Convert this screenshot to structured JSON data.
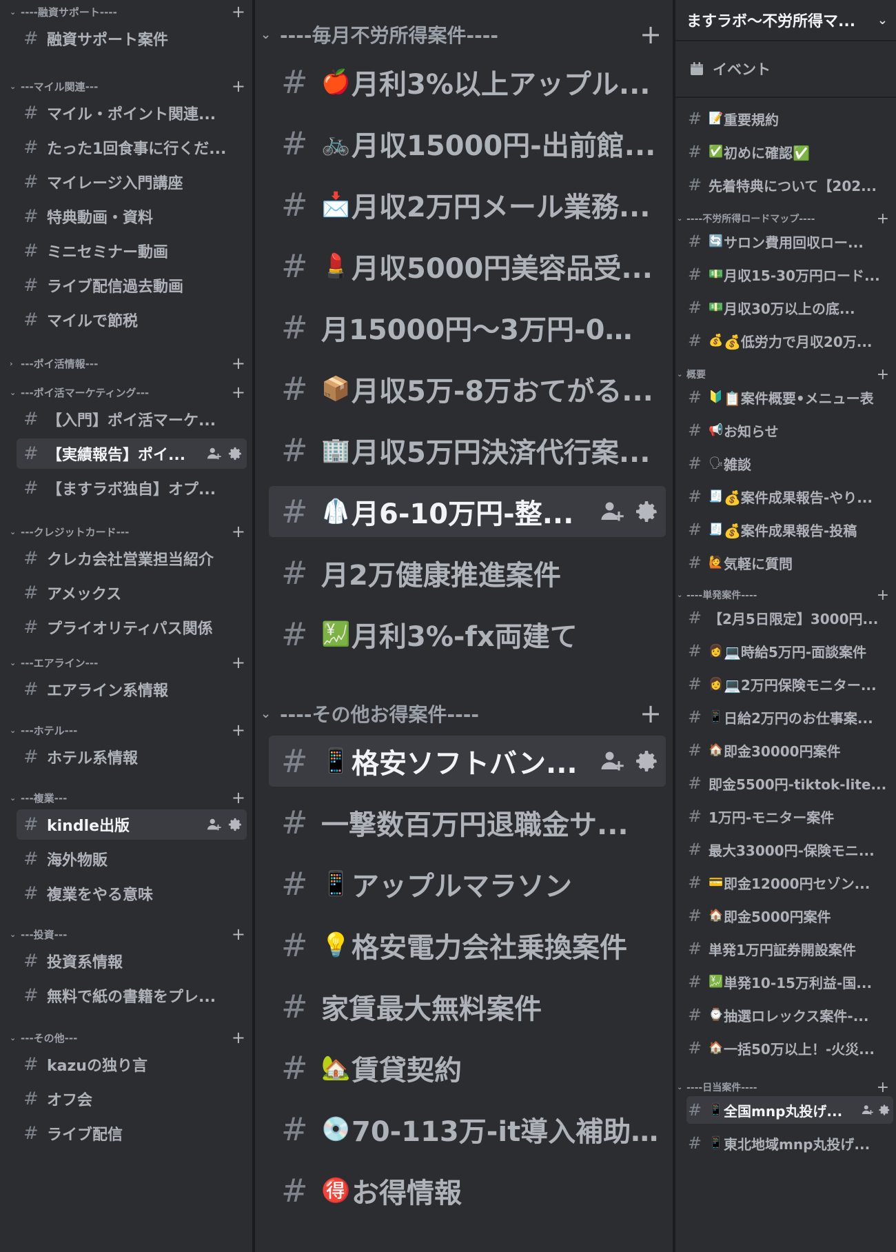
{
  "col1": {
    "groups": [
      {
        "category": "----融資サポート----",
        "chevron": "⌄",
        "channels": [
          {
            "name": "融資サポート案件"
          }
        ]
      },
      {
        "category": "---マイル関連---",
        "chevron": "⌄",
        "channels": [
          {
            "name": "マイル・ポイント関連..."
          },
          {
            "name": "たった1回食事に行くだ..."
          },
          {
            "name": "マイレージ入門講座"
          },
          {
            "name": "特典動画・資料"
          },
          {
            "name": "ミニセミナー動画"
          },
          {
            "name": "ライブ配信過去動画"
          },
          {
            "name": "マイルで節税"
          }
        ]
      },
      {
        "category": "---ポイ活情報---",
        "chevron": "›",
        "channels": []
      },
      {
        "category": "---ポイ活マーケティング---",
        "chevron": "⌄",
        "channels": [
          {
            "name": "【入門】ポイ活マーケ..."
          },
          {
            "name": "【実績報告】ポイ...",
            "selected": true
          },
          {
            "name": "【ますラボ独自】オプ..."
          }
        ]
      },
      {
        "category": "---クレジットカード---",
        "chevron": "⌄",
        "channels": [
          {
            "name": "クレカ会社営業担当紹介"
          },
          {
            "name": "アメックス"
          },
          {
            "name": "プライオリティパス関係"
          }
        ]
      },
      {
        "category": "---エアライン---",
        "chevron": "⌄",
        "channels": [
          {
            "name": "エアライン系情報"
          }
        ]
      },
      {
        "category": "---ホテル---",
        "chevron": "⌄",
        "channels": [
          {
            "name": "ホテル系情報"
          }
        ]
      },
      {
        "category": "---複業---",
        "chevron": "⌄",
        "channels": [
          {
            "name": "kindle出版",
            "selected": true
          },
          {
            "name": "海外物販"
          },
          {
            "name": "複業をやる意味"
          }
        ]
      },
      {
        "category": "---投資---",
        "chevron": "⌄",
        "channels": [
          {
            "name": "投資系情報"
          },
          {
            "name": "無料で紙の書籍をプレ..."
          }
        ]
      },
      {
        "category": "---その他---",
        "chevron": "⌄",
        "channels": [
          {
            "name": "kazuの独り言"
          },
          {
            "name": "オフ会"
          },
          {
            "name": "ライブ配信"
          }
        ]
      }
    ]
  },
  "col2": {
    "groups": [
      {
        "category": "----毎月不労所得案件----",
        "chevron": "⌄",
        "channels": [
          {
            "emoji": "🍎",
            "name": "月利3%以上アップル..."
          },
          {
            "emoji": "🚲",
            "name": "月収15000円-出前館..."
          },
          {
            "emoji": "📩",
            "name": "月収2万円メール業務..."
          },
          {
            "emoji": "💄",
            "name": "月収5000円美容品受..."
          },
          {
            "emoji": "",
            "name": "月15000円〜3万円-0円..."
          },
          {
            "emoji": "📦",
            "name": "月収5万-8万おてがる..."
          },
          {
            "emoji": "🏢",
            "name": "月収5万円決済代行案..."
          },
          {
            "emoji": "🥼",
            "name": "月6-10万円-整...",
            "selected": true
          },
          {
            "emoji": "",
            "name": "月2万健康推進案件"
          },
          {
            "emoji": "💹",
            "name": "月利3%-fx両建て"
          }
        ]
      },
      {
        "category": "----その他お得案件----",
        "chevron": "⌄",
        "channels": [
          {
            "emoji": "📱",
            "name": "格安ソフトバン...",
            "selected": true
          },
          {
            "emoji": "",
            "name": "一撃数百万円退職金サ..."
          },
          {
            "emoji": "📱",
            "name": "アップルマラソン"
          },
          {
            "emoji": "💡",
            "name": "格安電力会社乗換案件"
          },
          {
            "emoji": "",
            "name": "家賃最大無料案件"
          },
          {
            "emoji": "🏡",
            "name": "賃貸契約"
          },
          {
            "emoji": "💿",
            "name": "70-113万-it導入補助..."
          },
          {
            "emoji": "🉐",
            "name": "お得情報",
            "unread": true
          }
        ]
      }
    ]
  },
  "col3": {
    "server_name": "ますラボ〜不労所得マ...",
    "events_label": "イベント",
    "groups": [
      {
        "category": "",
        "chevron": "",
        "channels": [
          {
            "emoji": "📝",
            "name": "重要規約"
          },
          {
            "emoji": "✅",
            "name": "初めに確認✅"
          },
          {
            "emoji": "",
            "name": "先着特典について【202..."
          }
        ]
      },
      {
        "category": "----不労所得ロードマップ----",
        "chevron": "⌄",
        "channels": [
          {
            "emoji": "🔄",
            "name": "サロン費用回収ロー..."
          },
          {
            "emoji": "💵",
            "name": "月収15-30万円ロード..."
          },
          {
            "emoji": "💵",
            "name": "月収30万以上の底..."
          },
          {
            "emoji": "💰",
            "name": "💰低労力で月収20万..."
          }
        ]
      },
      {
        "category": "概要",
        "chevron": "⌄",
        "channels": [
          {
            "emoji": "🔰",
            "name": "📋案件概要•メニュー表"
          },
          {
            "emoji": "📢",
            "name": "お知らせ"
          },
          {
            "emoji": "🗣",
            "name": "雑談"
          },
          {
            "emoji": "🧾",
            "name": "💰案件成果報告-やり..."
          },
          {
            "emoji": "🧾",
            "name": "💰案件成果報告-投稿",
            "unread": true
          },
          {
            "emoji": "🙋",
            "name": "気軽に質問",
            "unread": true
          }
        ]
      },
      {
        "category": "----単発案件----",
        "chevron": "⌄",
        "channels": [
          {
            "emoji": "",
            "name": "【2月5日限定】3000円..."
          },
          {
            "emoji": "👩",
            "name": "💻時給5万円-面談案件"
          },
          {
            "emoji": "👩",
            "name": "💻2万円保険モニター..."
          },
          {
            "emoji": "📱",
            "name": "日給2万円のお仕事案..."
          },
          {
            "emoji": "🏠",
            "name": "即金30000円案件"
          },
          {
            "emoji": "",
            "name": "即金5500円-tiktok-lite..."
          },
          {
            "emoji": "",
            "name": "1万円-モニター案件"
          },
          {
            "emoji": "",
            "name": "最大33000円-保険モニ..."
          },
          {
            "emoji": "💳",
            "name": "即金12000円セゾン..."
          },
          {
            "emoji": "🏠",
            "name": "即金5000円案件"
          },
          {
            "emoji": "",
            "name": "単発1万円証券開設案件"
          },
          {
            "emoji": "💹",
            "name": "単発10-15万利益-国..."
          },
          {
            "emoji": "⌚",
            "name": "抽選ロレックス案件-..."
          },
          {
            "emoji": "🏠",
            "name": "一括50万以上！-火災..."
          }
        ]
      },
      {
        "category": "----日当案件----",
        "chevron": "⌄",
        "channels": [
          {
            "emoji": "📱",
            "name": "全国mnp丸投げ...",
            "selected": true,
            "unread": true
          },
          {
            "emoji": "📱",
            "name": "東北地域mnp丸投げ..."
          }
        ]
      }
    ]
  }
}
